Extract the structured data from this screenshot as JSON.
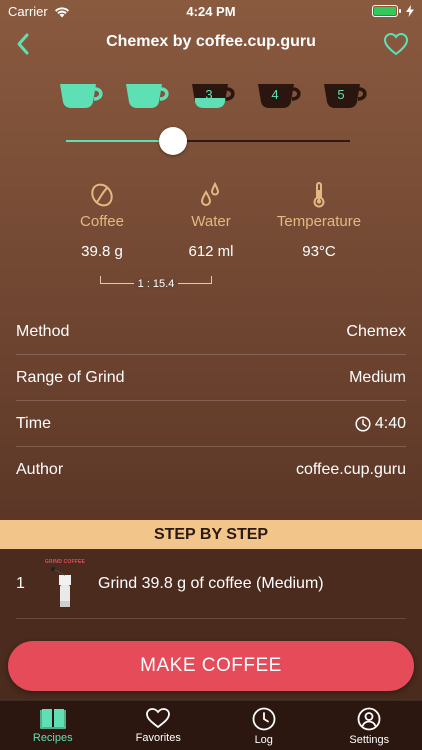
{
  "status_bar": {
    "carrier": "Carrier",
    "time": "4:24 PM"
  },
  "nav": {
    "title": "Chemex by coffee.cup.guru",
    "back_icon": "chevron-left-icon",
    "favorite_icon": "heart-icon"
  },
  "cups": [
    {
      "label": "",
      "selected": true
    },
    {
      "label": "",
      "selected": true
    },
    {
      "label": "3",
      "selected": true
    },
    {
      "label": "4",
      "selected": false
    },
    {
      "label": "5",
      "selected": false
    }
  ],
  "slider": {
    "value": 0.375
  },
  "params": [
    {
      "label": "Coffee",
      "value": "39.8 g",
      "icon": "coffee-bean-icon"
    },
    {
      "label": "Water",
      "value": "612 ml",
      "icon": "water-drops-icon"
    },
    {
      "label": "Temperature",
      "value": "93°C",
      "icon": "thermometer-icon"
    }
  ],
  "ratio": "1 : 15.4",
  "details": [
    {
      "label": "Method",
      "value": "Chemex"
    },
    {
      "label": "Range of Grind",
      "value": "Medium"
    },
    {
      "label": "Time",
      "value": "4:40",
      "icon": "clock-icon"
    },
    {
      "label": "Author",
      "value": "coffee.cup.guru"
    }
  ],
  "steps_header": "STEP BY STEP",
  "steps": [
    {
      "number": "1",
      "image_caption": "GRIND COFFEE",
      "text": "Grind 39.8 g of coffee (Medium)"
    }
  ],
  "make_button": "MAKE COFFEE",
  "tabs": [
    {
      "label": "Recipes",
      "icon": "book-icon",
      "active": true
    },
    {
      "label": "Favorites",
      "icon": "heart-icon",
      "active": false
    },
    {
      "label": "Log",
      "icon": "clock-icon",
      "active": false
    },
    {
      "label": "Settings",
      "icon": "user-icon",
      "active": false
    }
  ],
  "colors": {
    "accent": "#5fe0b4",
    "label_tan": "#e5b783",
    "button": "#e64b5a",
    "header_band": "#f2c58a"
  }
}
